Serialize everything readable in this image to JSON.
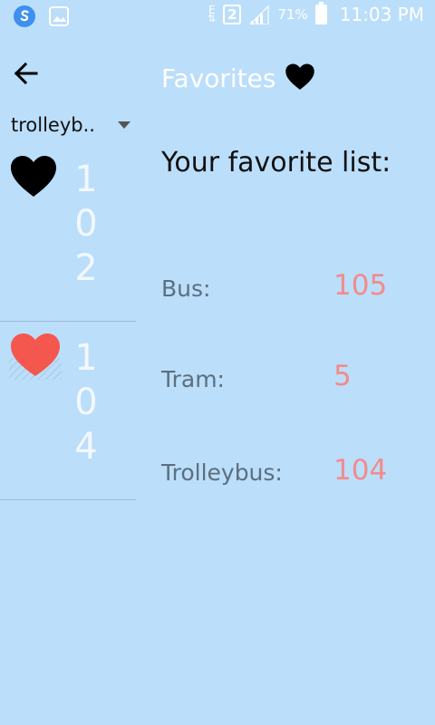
{
  "status_bar": {
    "network_label": "E",
    "sim_label": "2",
    "battery_percent": "71%",
    "time": "11:03 PM",
    "icons": [
      "shazam-icon",
      "gallery-icon",
      "data-arrows-icon",
      "signal-icon",
      "battery-icon"
    ]
  },
  "toolbar": {
    "back_icon": "arrow-left-icon",
    "spinner_value": "trolleyb..",
    "title": "Favorites",
    "title_icon": "heart-icon"
  },
  "sidebar": {
    "items": [
      {
        "number": "102",
        "digits": [
          "1",
          "0",
          "2"
        ],
        "favorite": false,
        "heart_color": "#000000"
      },
      {
        "number": "104",
        "digits": [
          "1",
          "0",
          "4"
        ],
        "favorite": true,
        "heart_color": "#f4574d"
      }
    ]
  },
  "main": {
    "heading": "Your favorite list:",
    "rows": [
      {
        "label": "Bus:",
        "value": "105"
      },
      {
        "label": "Tram:",
        "value": "5"
      },
      {
        "label": "Trolleybus:",
        "value": "104"
      }
    ]
  },
  "colors": {
    "background": "#bbdefa",
    "value_text": "#f28b8b",
    "favorite_heart": "#f4574d"
  }
}
